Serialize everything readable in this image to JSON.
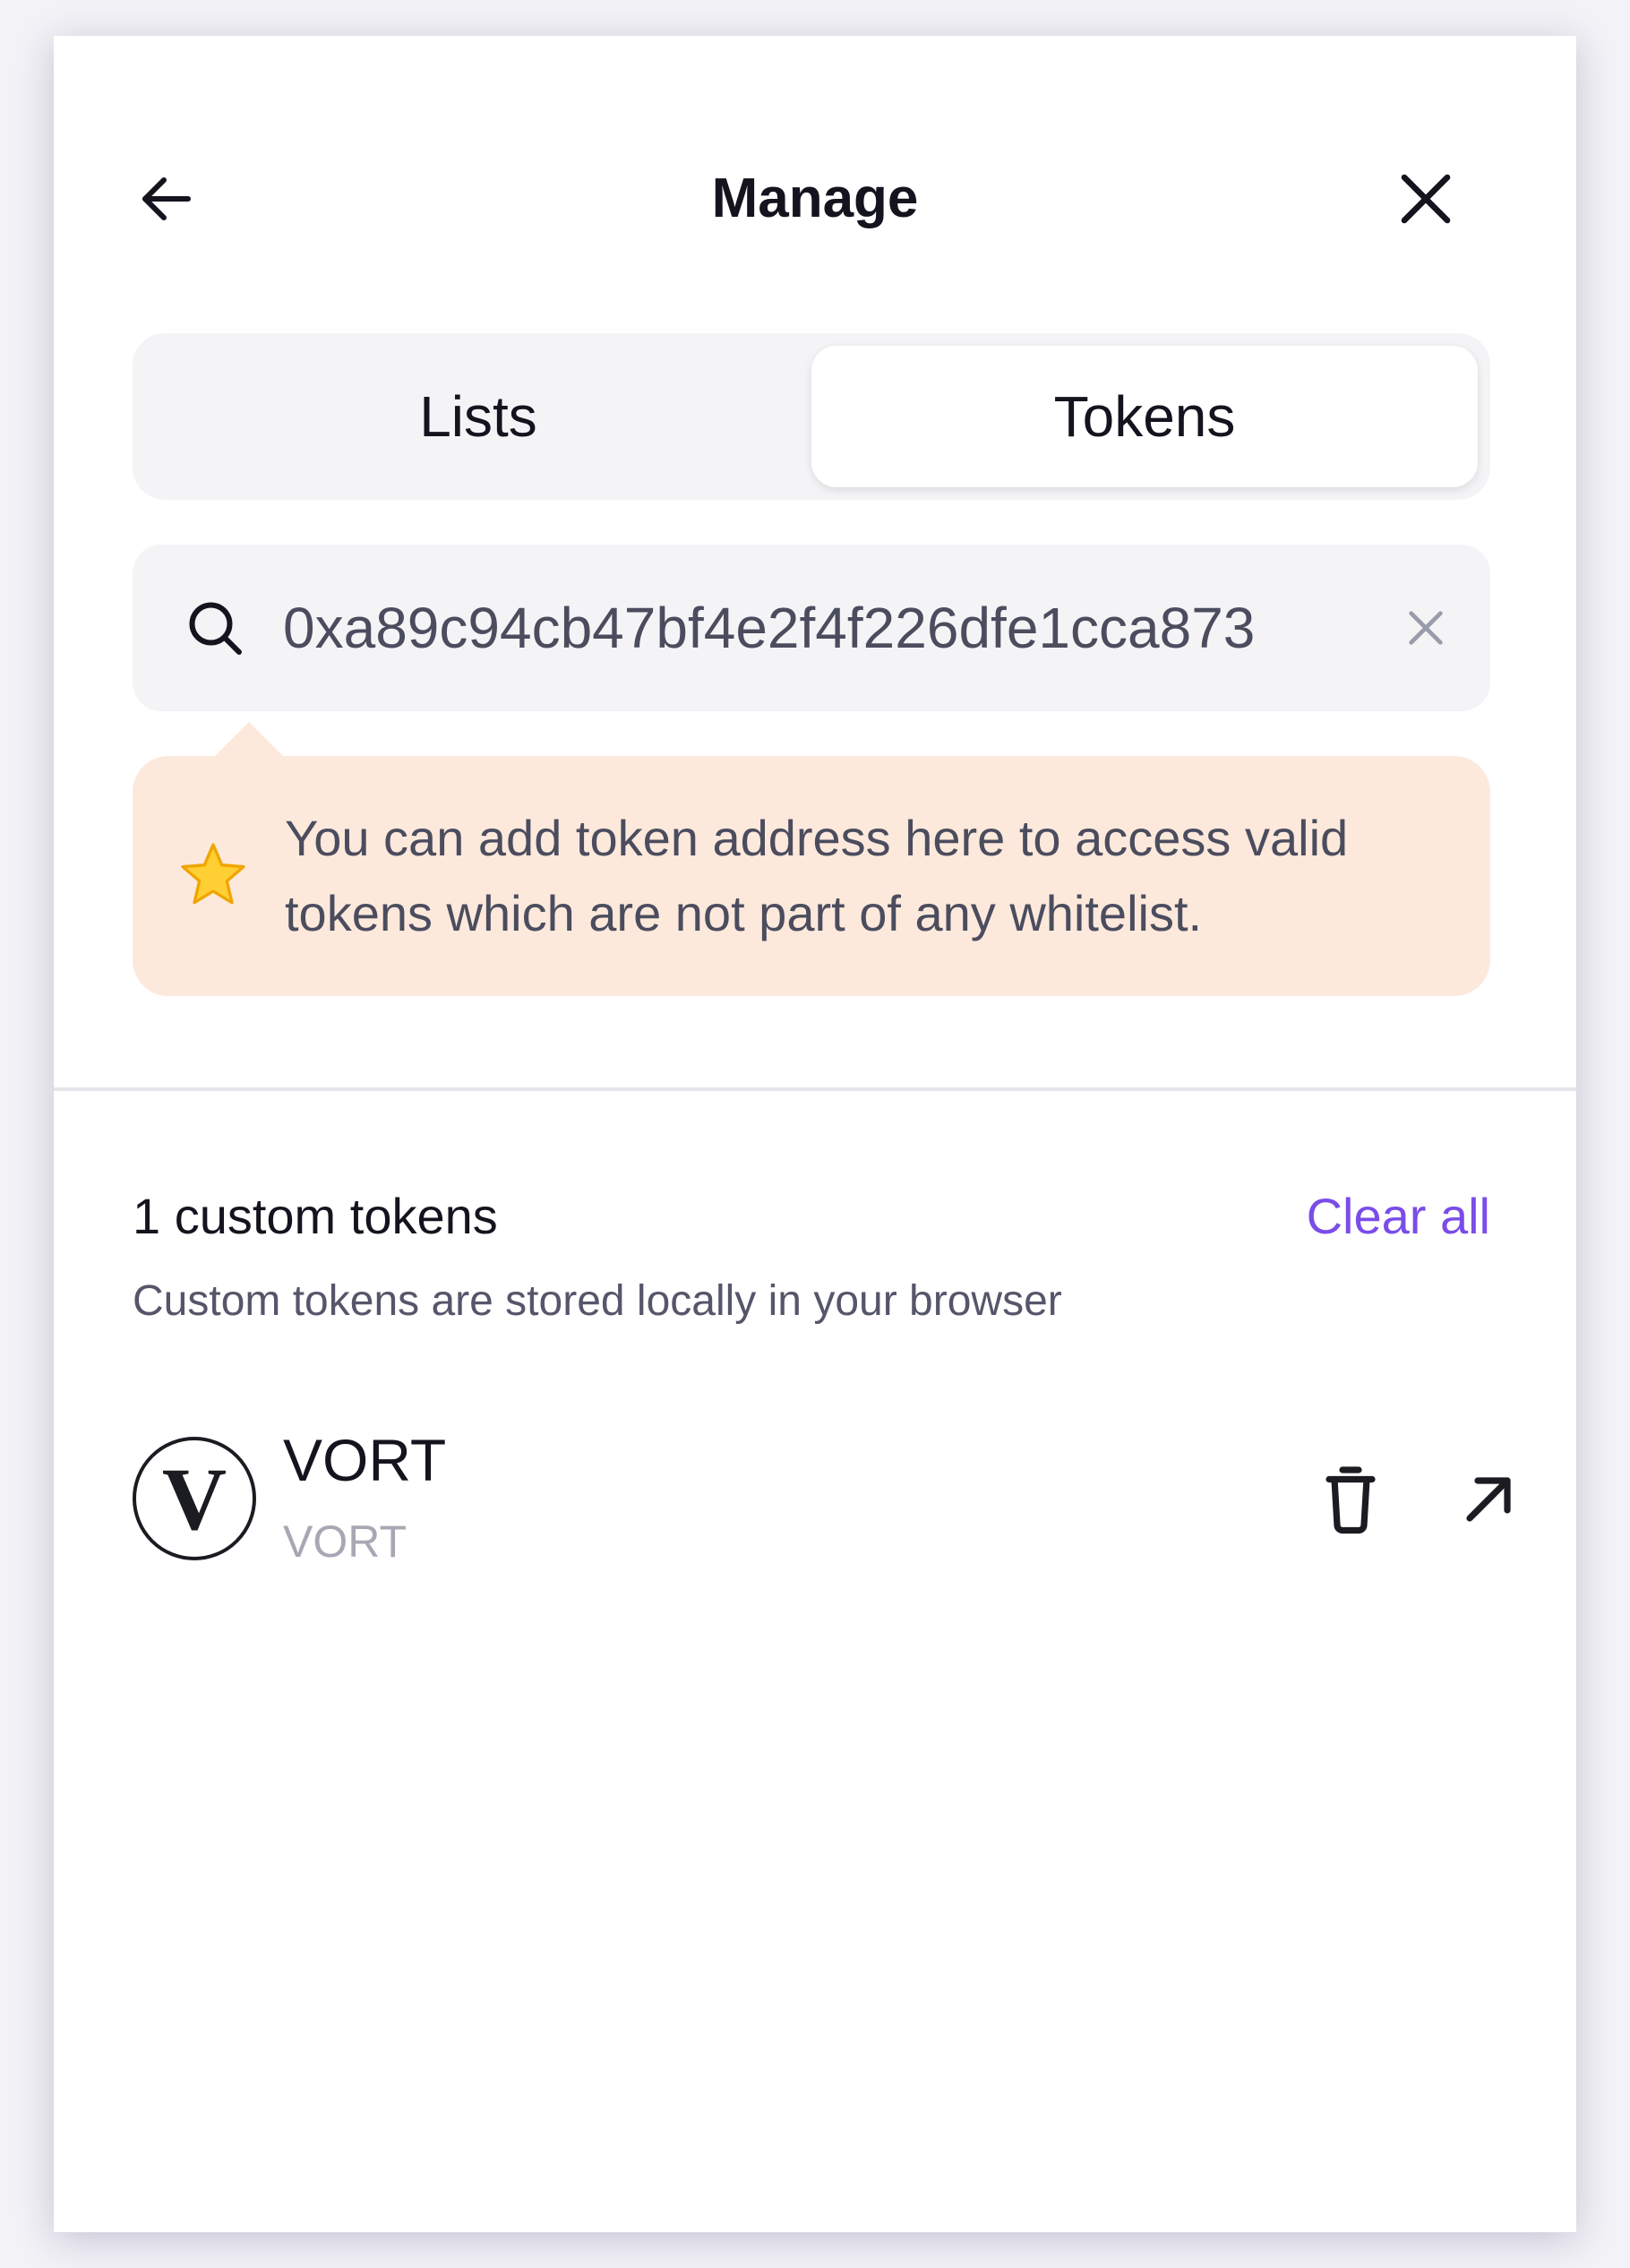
{
  "header": {
    "title": "Manage",
    "back_icon": "arrow-left-icon",
    "close_icon": "close-icon"
  },
  "tabs": [
    {
      "label": "Lists",
      "active": false
    },
    {
      "label": "Tokens",
      "active": true
    }
  ],
  "search": {
    "value": "0xa89c94cb47bf4e2f4f226dfe1cca873",
    "icon": "search-icon",
    "clear_icon": "clear-icon"
  },
  "tip": {
    "icon": "star-icon",
    "text_line1": "You can add token address here to access valid",
    "text_line2": "tokens which are not part of any whitelist."
  },
  "custom_tokens": {
    "title": "1 custom tokens",
    "clear_all_label": "Clear all",
    "subtitle": "Custom tokens are stored locally in your browser",
    "items": [
      {
        "logo_letter": "V",
        "name": "VORT",
        "symbol": "VORT"
      }
    ]
  },
  "colors": {
    "accent": "#7a4de8",
    "tip_background": "#fde9dc",
    "panel_background": "#f4f4f6"
  }
}
